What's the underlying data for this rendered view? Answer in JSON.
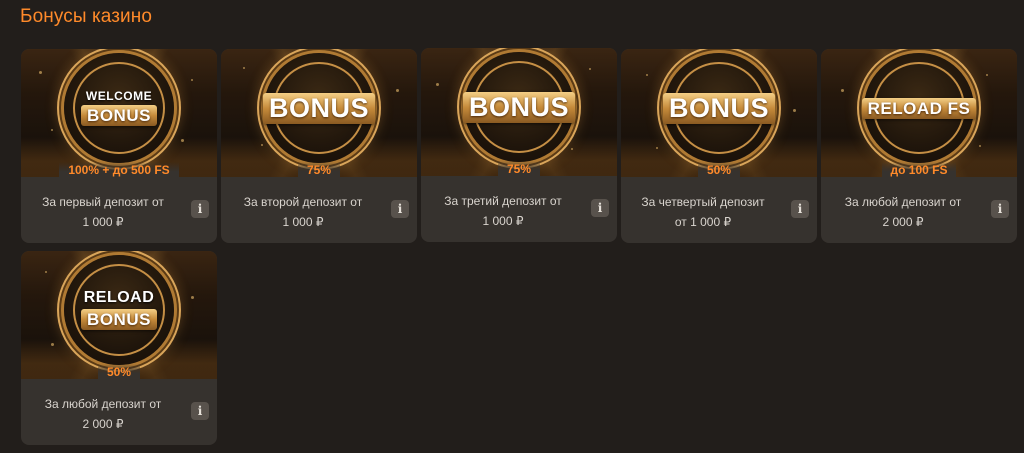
{
  "page": {
    "title": "Бонусы казино"
  },
  "colors": {
    "accent": "#ff8a2a",
    "card_bg": "#36322e",
    "page_bg": "#221e1b",
    "gold": "#c58a3a"
  },
  "bonuses": [
    {
      "badge_top": "WELCOME",
      "badge_main": "BONUS",
      "amount": "100% + до 500 FS",
      "desc_line1": "За первый депозит от",
      "desc_line2": "1 000 ₽",
      "info_icon": "i"
    },
    {
      "badge_top": "",
      "badge_main": "BONUS",
      "amount": "75%",
      "desc_line1": "За второй депозит от",
      "desc_line2": "1 000 ₽",
      "info_icon": "i"
    },
    {
      "badge_top": "",
      "badge_main": "BONUS",
      "amount": "75%",
      "desc_line1": "За третий депозит от",
      "desc_line2": "1 000 ₽",
      "info_icon": "i"
    },
    {
      "badge_top": "",
      "badge_main": "BONUS",
      "amount": "50%",
      "desc_line1": "За четвертый депозит",
      "desc_line2": "от 1 000 ₽",
      "info_icon": "i"
    },
    {
      "badge_top": "",
      "badge_main": "RELOAD FS",
      "amount": "до 100 FS",
      "desc_line1": "За любой депозит от",
      "desc_line2": "2 000 ₽",
      "info_icon": "i"
    },
    {
      "badge_top": "RELOAD",
      "badge_main": "BONUS",
      "amount": "50%",
      "desc_line1": "За любой депозит от",
      "desc_line2": "2 000 ₽",
      "info_icon": "i"
    }
  ]
}
